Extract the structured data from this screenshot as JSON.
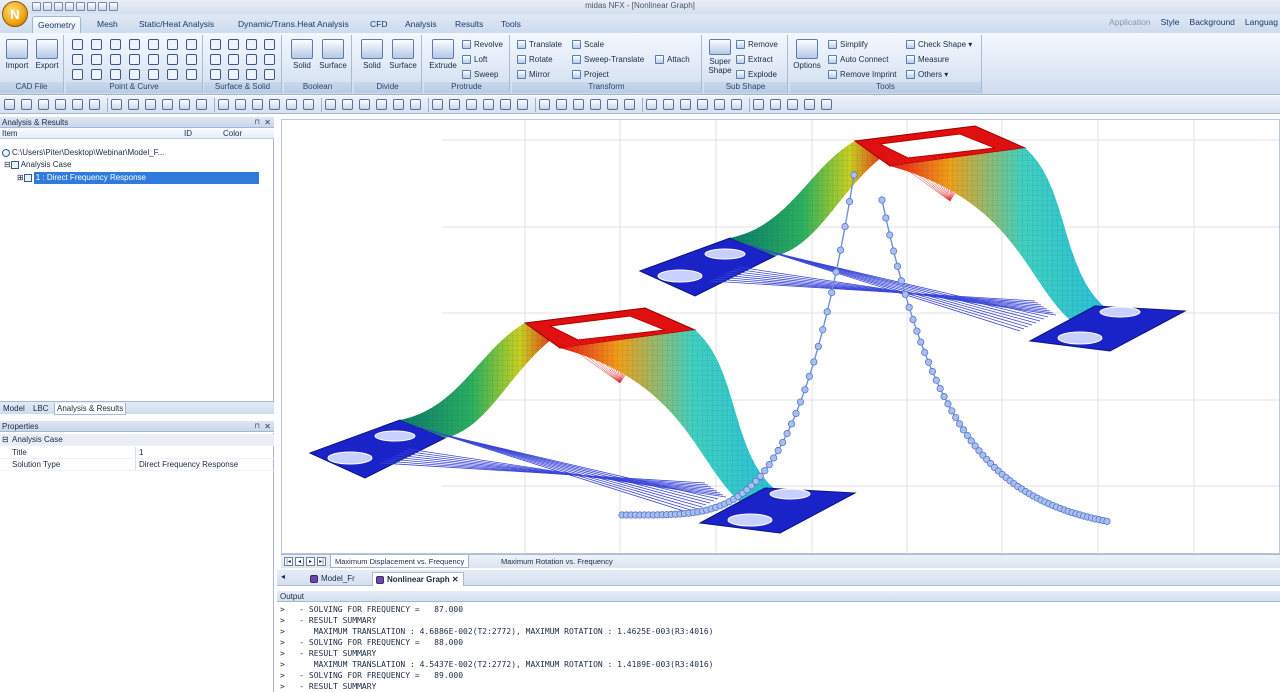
{
  "window": {
    "title": "midas NFX - [Nonlinear Graph]"
  },
  "tabs": [
    "Geometry",
    "Mesh",
    "Static/Heat Analysis",
    "Dynamic/Trans.Heat Analysis",
    "CFD",
    "Analysis",
    "Results",
    "Tools"
  ],
  "right_menu": {
    "application": "Application",
    "style": "Style",
    "background": "Background",
    "language": "Languag"
  },
  "ribbon": {
    "cad_file": {
      "label": "CAD File",
      "import": "Import",
      "export": "Export"
    },
    "point_curve": {
      "label": "Point & Curve"
    },
    "surface_solid": {
      "label": "Surface & Solid"
    },
    "boolean": {
      "label": "Boolean",
      "solid": "Solid",
      "surface": "Surface"
    },
    "divide": {
      "label": "Divide",
      "solid": "Solid",
      "surface": "Surface"
    },
    "protrude": {
      "label": "Protrude",
      "extrude": "Extrude",
      "revolve": "Revolve",
      "loft": "Loft",
      "sweep": "Sweep"
    },
    "transform": {
      "label": "Transform",
      "translate": "Translate",
      "scale": "Scale",
      "rotate": "Rotate",
      "sweep_translate": "Sweep-Translate",
      "attach": "Attach",
      "mirror": "Mirror",
      "project": "Project"
    },
    "sub_shape": {
      "label": "Sub Shape",
      "super_shape_1": "Super",
      "super_shape_2": "Shape",
      "remove": "Remove",
      "extract": "Extract",
      "explode": "Explode"
    },
    "tools": {
      "label": "Tools",
      "options": "Options",
      "simplify": "Simplify",
      "auto_connect": "Auto Connect",
      "remove_imprint": "Remove Imprint",
      "check_shape": "Check Shape",
      "measure": "Measure",
      "others": "Others"
    }
  },
  "analysis_panel": {
    "title": "Analysis & Results",
    "headers": {
      "item": "Item",
      "id": "ID",
      "color": "Color"
    },
    "root": "C:\\Users\\Piter\\Desktop\\Webinar\\Model_F...",
    "analysis_case": "Analysis Case",
    "selected_case": "1 : Direct Frequency Response"
  },
  "panel_tabs": [
    "Model",
    "LBC",
    "Analysis & Results"
  ],
  "properties": {
    "title": "Properties",
    "group": "Analysis Case",
    "rows": [
      {
        "key": "Title",
        "value": "1"
      },
      {
        "key": "Solution Type",
        "value": "Direct Frequency Response"
      }
    ]
  },
  "sheet_tabs": [
    "Maximum Displacement vs. Frequency",
    "Maximum Rotation vs. Frequency"
  ],
  "doc_tabs": [
    "Model_Fr",
    "Nonlinear Graph"
  ],
  "output": {
    "title": "Output",
    "lines": [
      ">   - SOLVING FOR FREQUENCY =   87.000",
      ">   - RESULT SUMMARY",
      ">      MAXIMUM TRANSLATION : 4.6886E-002(T2:2772), MAXIMUM ROTATION : 1.4625E-003(R3:4016)",
      ">   - SOLVING FOR FREQUENCY =   88.000",
      ">   - RESULT SUMMARY",
      ">      MAXIMUM TRANSLATION : 4.5437E-002(T2:2772), MAXIMUM ROTATION : 1.4189E-003(R3:4016)",
      ">   - SOLVING FOR FREQUENCY =   89.000",
      ">   - RESULT SUMMARY"
    ]
  },
  "colors": {
    "accent": "#2e7bdc",
    "curve": "#6f8fd6",
    "point": "#a8bff2",
    "hot": "#e01010",
    "cold": "#1a23c8"
  }
}
